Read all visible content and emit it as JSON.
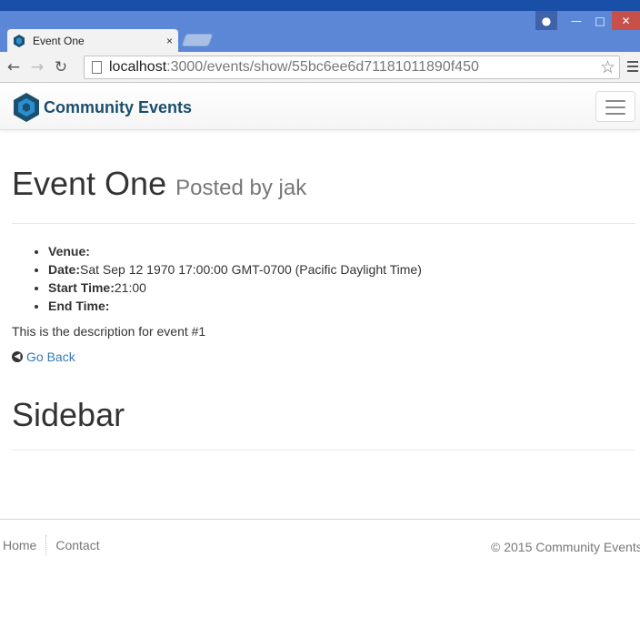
{
  "browser": {
    "tab_title": "Event One",
    "tab_close": "×",
    "url_host": "localhost",
    "url_path": ":3000/events/show/55bc6ee6d71181011890f450"
  },
  "navbar": {
    "brand": "Community Events"
  },
  "event": {
    "title": "Event One",
    "posted_by": "Posted by jak",
    "details": [
      {
        "label": "Venue:",
        "value": ""
      },
      {
        "label": "Date:",
        "value": "Sat Sep 12 1970 17:00:00 GMT-0700 (Pacific Daylight Time)"
      },
      {
        "label": "Start Time:",
        "value": "21:00"
      },
      {
        "label": "End Time:",
        "value": ""
      }
    ],
    "description": "This is the description for event #1",
    "back_label": "Go Back"
  },
  "sidebar": {
    "title": "Sidebar"
  },
  "footer": {
    "links": [
      "Home",
      "Contact"
    ],
    "copyright": "© 2015 Community Events"
  },
  "colors": {
    "link": "#337ab7",
    "brand": "#1b4f6e",
    "chrome": "#5b87d6"
  }
}
